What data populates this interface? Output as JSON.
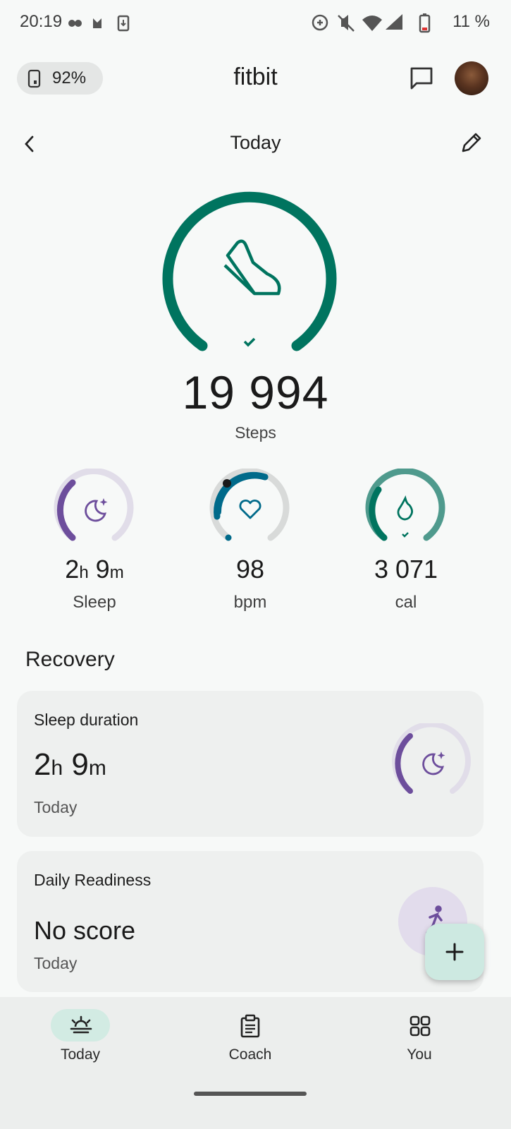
{
  "status_bar": {
    "time": "20:19",
    "battery": "11 %"
  },
  "header": {
    "device_battery": "92%",
    "app_title": "fitbit",
    "message_icon": "message-square-icon",
    "avatar": "user-avatar"
  },
  "nav": {
    "title": "Today",
    "back_icon": "chevron-left-icon",
    "edit_icon": "pencil-icon"
  },
  "steps": {
    "value": "19 994",
    "label": "Steps",
    "goal_progress": 1.0,
    "icon": "shoe-icon",
    "color": "#00745f"
  },
  "metrics": [
    {
      "value_num1": "2",
      "unit1": "h",
      "value_num2": " 9",
      "unit2": "m",
      "label": "Sleep",
      "icon": "moon-icon",
      "color": "#6d4e9c"
    },
    {
      "value": "98",
      "label": "bpm",
      "icon": "heart-icon",
      "color": "#006a8a"
    },
    {
      "value": "3 071",
      "label": "cal",
      "icon": "flame-icon",
      "color": "#00745f"
    }
  ],
  "recovery": {
    "section_title": "Recovery",
    "sleep_card": {
      "title": "Sleep duration",
      "hours": "2",
      "h_unit": "h",
      "minutes": " 9",
      "m_unit": "m",
      "sub": "Today"
    },
    "readiness_card": {
      "title": "Daily Readiness",
      "value": "No score",
      "sub": "Today"
    }
  },
  "fab": {
    "icon": "plus-icon"
  },
  "bottom_nav": {
    "tabs": [
      {
        "label": "Today",
        "icon": "sunrise-icon",
        "active": true
      },
      {
        "label": "Coach",
        "icon": "clipboard-icon",
        "active": false
      },
      {
        "label": "You",
        "icon": "grid-icon",
        "active": false
      }
    ]
  }
}
